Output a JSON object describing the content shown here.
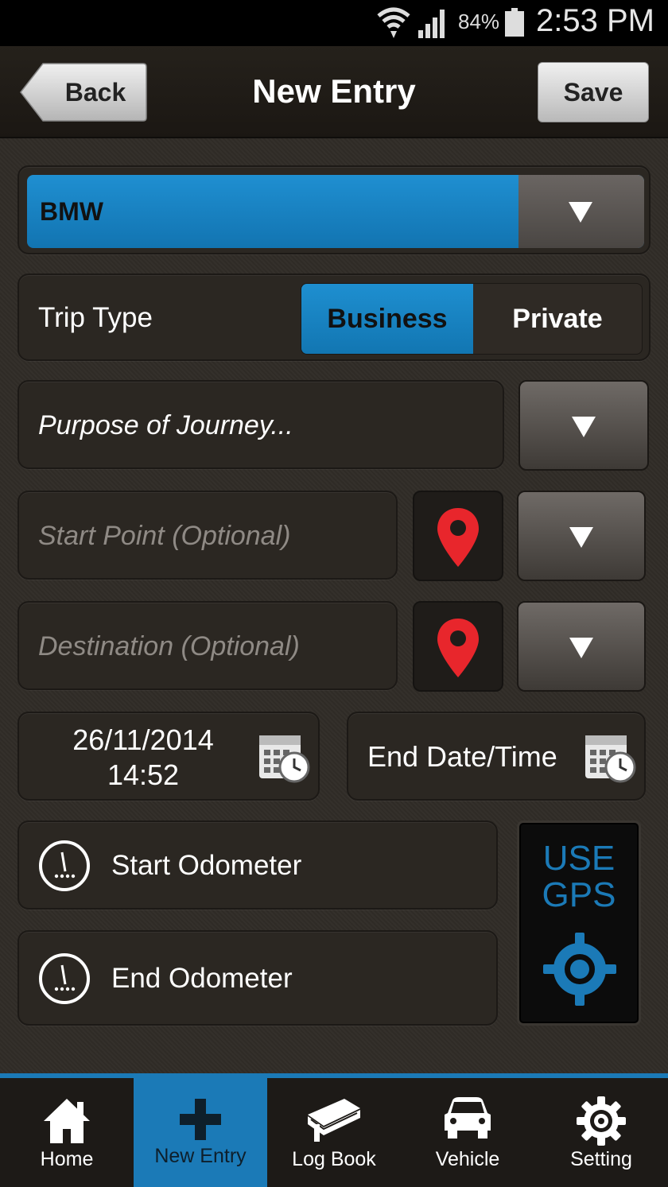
{
  "status_bar": {
    "battery": "84%",
    "time": "2:53 PM"
  },
  "header": {
    "back_label": "Back",
    "title": "New Entry",
    "save_label": "Save"
  },
  "vehicle": {
    "selected": "BMW"
  },
  "trip_type": {
    "label": "Trip Type",
    "options": [
      "Business",
      "Private"
    ],
    "selected": "Business"
  },
  "purpose": {
    "placeholder": "Purpose of Journey..."
  },
  "start_point": {
    "placeholder": "Start Point (Optional)"
  },
  "destination": {
    "placeholder": "Destination (Optional)"
  },
  "start_datetime": {
    "date": "26/11/2014",
    "time": "14:52"
  },
  "end_datetime": {
    "label": "End Date/Time"
  },
  "odometer": {
    "start_label": "Start Odometer",
    "end_label": "End Odometer"
  },
  "gps": {
    "line1": "USE",
    "line2": "GPS"
  },
  "nav": {
    "items": [
      {
        "label": "Home",
        "icon": "home-icon"
      },
      {
        "label": "New Entry",
        "icon": "plus-icon"
      },
      {
        "label": "Log Book",
        "icon": "book-icon"
      },
      {
        "label": "Vehicle",
        "icon": "car-icon"
      },
      {
        "label": "Setting",
        "icon": "gear-icon"
      }
    ],
    "active": "New Entry"
  },
  "colors": {
    "accent": "#1b7ab7",
    "pin": "#e8262c",
    "background": "#302c27"
  }
}
